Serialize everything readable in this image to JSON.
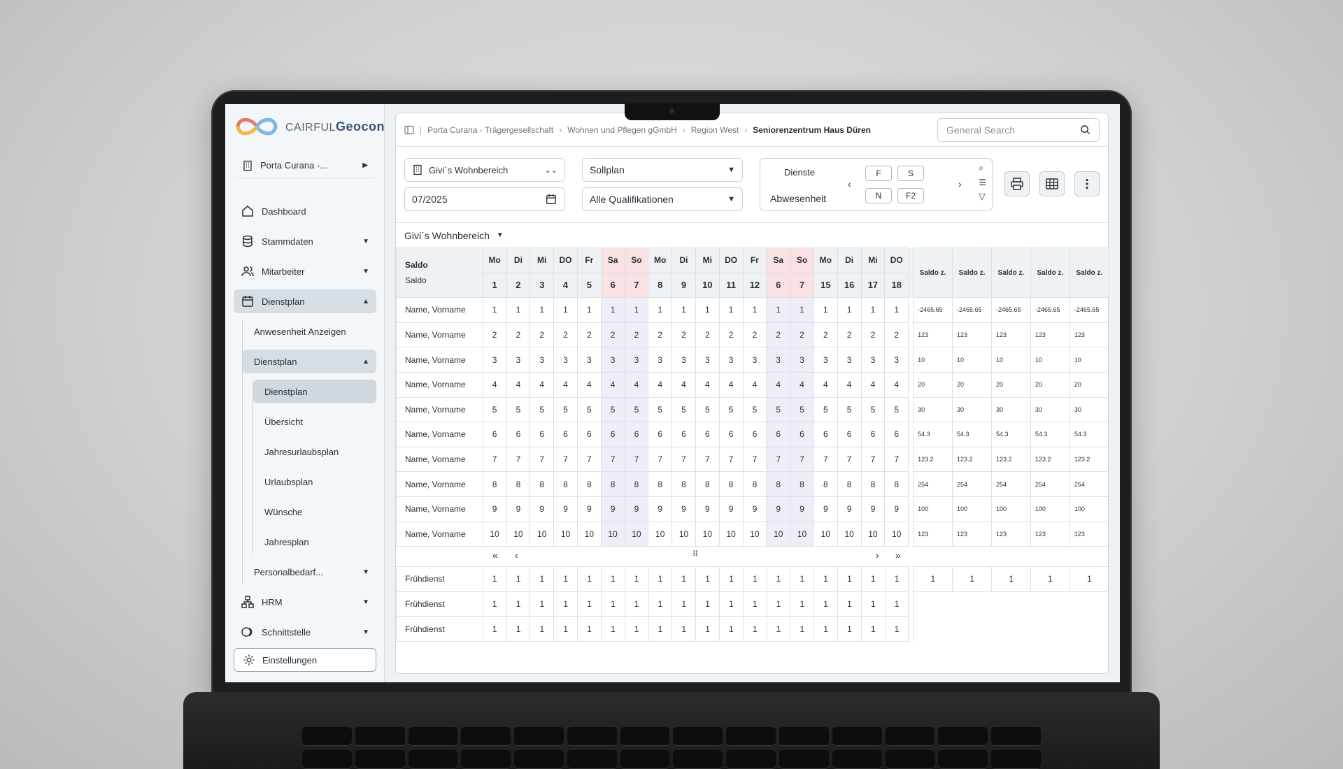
{
  "app": {
    "logo_brand": "CAIRFUL",
    "logo_product": "Geocon",
    "org": "Porta Curana -..."
  },
  "sidebar": {
    "items": [
      {
        "label": "Dashboard",
        "icon": "home-icon"
      },
      {
        "label": "Stammdaten",
        "icon": "database-icon"
      },
      {
        "label": "Mitarbeiter",
        "icon": "users-icon"
      },
      {
        "label": "Dienstplan",
        "icon": "calendar-icon"
      }
    ],
    "dienstplan_sub": [
      {
        "label": "Anwesenheit Anzeigen"
      },
      {
        "label": "Dienstplan"
      }
    ],
    "dienstplan_sub2": [
      {
        "label": "Dienstplan"
      },
      {
        "label": "Übersicht"
      },
      {
        "label": "Jahresurlaubsplan"
      },
      {
        "label": "Urlaubsplan"
      },
      {
        "label": "Wünsche"
      },
      {
        "label": "Jahresplan"
      }
    ],
    "personalbedarf": "Personalbedarf...",
    "hrm": "HRM",
    "schnittstelle": "Schnittstelle",
    "settings": "Einstellungen"
  },
  "breadcrumb": [
    "Porta Curana - Trägergesellschaft",
    "Wohnen und Pflegen gGmbH",
    "Region West",
    "Seniorenzentrum Haus Düren"
  ],
  "search": {
    "placeholder": "General Search"
  },
  "filters": {
    "area": "Givi´s Wohnbereich",
    "date": "07/2025",
    "plan": "Sollplan",
    "qualification": "Alle Qualifikationen",
    "dienste_label": "Dienste",
    "abwesenheit_label": "Abwesenheit",
    "chips": [
      "F",
      "S",
      "N",
      "F2"
    ]
  },
  "section": {
    "title": "Givi´s Wohnbereich"
  },
  "table": {
    "saldo_label": "Saldo",
    "saldo_sub": "Saldo",
    "days": [
      "Mo",
      "Di",
      "Mi",
      "DO",
      "Fr",
      "Sa",
      "So",
      "Mo",
      "Di",
      "Mi",
      "DO",
      "Fr",
      "Sa",
      "So",
      "Mo",
      "Di",
      "Mi",
      "DO"
    ],
    "dates": [
      "1",
      "2",
      "3",
      "4",
      "5",
      "6",
      "7",
      "8",
      "9",
      "10",
      "11",
      "12",
      "6",
      "7",
      "15",
      "16",
      "17",
      "18"
    ],
    "weekend_idx": [
      5,
      6,
      12,
      13
    ],
    "saldo_headers": [
      "Saldo z.",
      "Saldo z.",
      "Saldo z.",
      "Saldo z.",
      "Saldo z."
    ],
    "rows": [
      {
        "name": "Name, Vorname",
        "value": "1",
        "saldo": "-2465.65"
      },
      {
        "name": "Name, Vorname",
        "value": "2",
        "saldo": "123"
      },
      {
        "name": "Name, Vorname",
        "value": "3",
        "saldo": "10"
      },
      {
        "name": "Name, Vorname",
        "value": "4",
        "saldo": "20"
      },
      {
        "name": "Name, Vorname",
        "value": "5",
        "saldo": "30"
      },
      {
        "name": "Name, Vorname",
        "value": "6",
        "saldo": "54.3"
      },
      {
        "name": "Name, Vorname",
        "value": "7",
        "saldo": "123.2"
      },
      {
        "name": "Name, Vorname",
        "value": "8",
        "saldo": "254"
      },
      {
        "name": "Name, Vorname",
        "value": "9",
        "saldo": "100"
      },
      {
        "name": "Name, Vorname",
        "value": "10",
        "saldo": "123"
      }
    ],
    "pager": {
      "first": "«",
      "prev": "‹",
      "handle": "⠿",
      "next": "›",
      "last": "»"
    },
    "summary_rows": [
      {
        "name": "Frühdienst",
        "value": "1",
        "totals": [
          "1",
          "1",
          "1",
          "1",
          "1"
        ]
      },
      {
        "name": "Frühdienst",
        "value": "1"
      },
      {
        "name": "Frühdienst",
        "value": "1"
      }
    ]
  }
}
